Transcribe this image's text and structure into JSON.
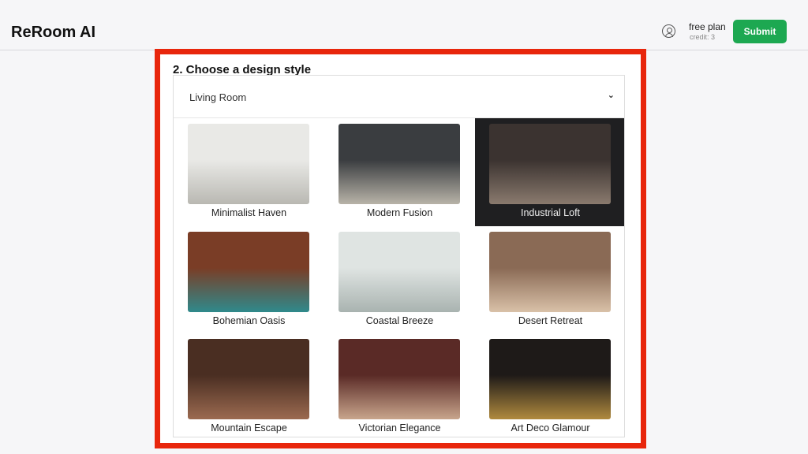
{
  "header": {
    "logo": "ReRoom AI",
    "plan": "free plan",
    "credit": "credit: 3",
    "submit_label": "Submit",
    "icons": {
      "user": "user-circle-icon"
    }
  },
  "section": {
    "title": "2. Choose a design style",
    "room_select": {
      "value": "Living Room",
      "icon": "chevron-down-icon"
    }
  },
  "styles": [
    {
      "label": "Minimalist Haven",
      "selected": false,
      "colors": [
        "#e9e9e6",
        "#b9b8b2"
      ]
    },
    {
      "label": "Modern Fusion",
      "selected": false,
      "colors": [
        "#3a3d40",
        "#b8b3a8"
      ]
    },
    {
      "label": "Industrial Loft",
      "selected": true,
      "colors": [
        "#3b3330",
        "#8a7a6e"
      ]
    },
    {
      "label": "Bohemian Oasis",
      "selected": false,
      "colors": [
        "#7a3d26",
        "#2f8a8c"
      ]
    },
    {
      "label": "Coastal Breeze",
      "selected": false,
      "colors": [
        "#dfe4e2",
        "#a9b3b0"
      ]
    },
    {
      "label": "Desert Retreat",
      "selected": false,
      "colors": [
        "#8a6a55",
        "#d9c1a8"
      ]
    },
    {
      "label": "Mountain Escape",
      "selected": false,
      "colors": [
        "#4a2e22",
        "#9b6a50"
      ]
    },
    {
      "label": "Victorian Elegance",
      "selected": false,
      "colors": [
        "#5a2a26",
        "#c8a58c"
      ]
    },
    {
      "label": "Art Deco Glamour",
      "selected": false,
      "colors": [
        "#1e1a18",
        "#b08a3e"
      ]
    }
  ],
  "accent": "#e8260c",
  "submit_color": "#1da851"
}
